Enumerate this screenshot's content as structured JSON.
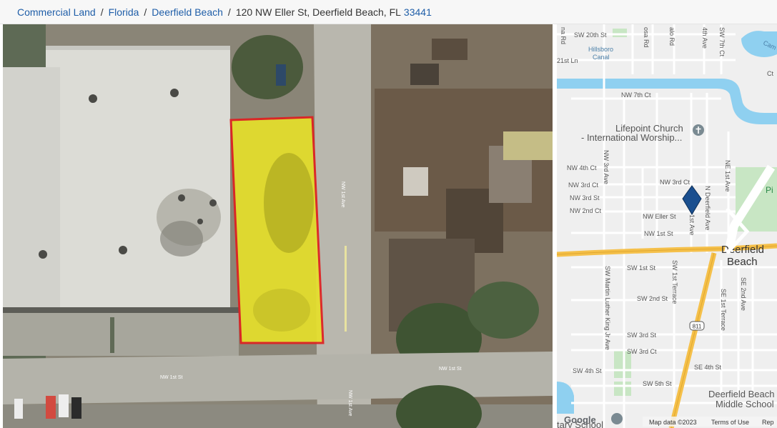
{
  "breadcrumb": {
    "commercial_land": "Commercial Land",
    "state": "Florida",
    "city": "Deerfield Beach",
    "separator": "/",
    "address": "120 NW Eller St, Deerfield Beach, FL",
    "zip": "33441"
  },
  "aerial": {
    "road_labels": [
      "NW 1st Ave",
      "NW 1st St",
      "NW 1st St",
      "NW 1st Ave"
    ]
  },
  "map": {
    "streets": {
      "sw_20th_st": "SW 20th St",
      "hillsboro_canal": "Hillsboro Canal",
      "hillsboro": "Hillsboro",
      "canal": "Canal",
      "nw_21st_ln": "21st Ln",
      "nw_7th_ct": "NW 7th Ct",
      "nw_4th_ct": "NW 4th Ct",
      "nw_3rd_ct": "NW 3rd Ct",
      "nw_3rd_ct_2": "NW 3rd Ct",
      "nw_3rd_st": "NW 3rd St",
      "nw_2nd_ct": "NW 2nd Ct",
      "nw_eller_st": "NW Eller St",
      "nw_1st_st": "NW 1st St",
      "sw_1st_st": "SW 1st St",
      "sw_2nd_st": "SW 2nd St",
      "sw_3rd_st": "SW 3rd St",
      "sw_3rd_ct": "SW 3rd Ct",
      "sw_4th_st": "SW 4th St",
      "sw_5th_st": "SW 5th St",
      "se_4th_st": "SE 4th St",
      "nw_3rd_ave": "NW 3rd Ave",
      "n_deerfield_ave": "N Deerfield Ave",
      "ne_1st_ave": "NE 1st Ave",
      "sw_mlk_ave": "SW Martin Luther King Jr Ave",
      "sw_1st_terrace": "SW 1st Terrace",
      "se_1st_terrace": "SE 1st Terrace",
      "se_2nd_ave": "SE 2nd Ave",
      "nw_1st_ave": "1st Ave",
      "route": "811",
      "sw_7th_ct": "SW 7th Ct",
      "nw_6th_ave": "4th Ave",
      "palo_rd": "alo Rd",
      "rosa_rd": "osa Rd",
      "na_rd": "na Rd",
      "cam": "Cam",
      "pi": "Pi",
      "ct": "Ct"
    },
    "poi": {
      "church_line1": "Lifepoint Church",
      "church_line2": "- International Worship...",
      "city_line1": "Deerfield",
      "city_line2": "Beach",
      "school_line1": "Deerfield Beach",
      "school_line2": "Middle School",
      "school_left": "tary School"
    },
    "attribution": {
      "logo": "Google",
      "data": "Map data ©2023",
      "terms": "Terms of Use",
      "report": "Rep"
    },
    "colors": {
      "water": "#8fd0f0",
      "highway": "#f5c04a",
      "pin": "#1a4f8f",
      "park": "#c8e6c4"
    }
  }
}
